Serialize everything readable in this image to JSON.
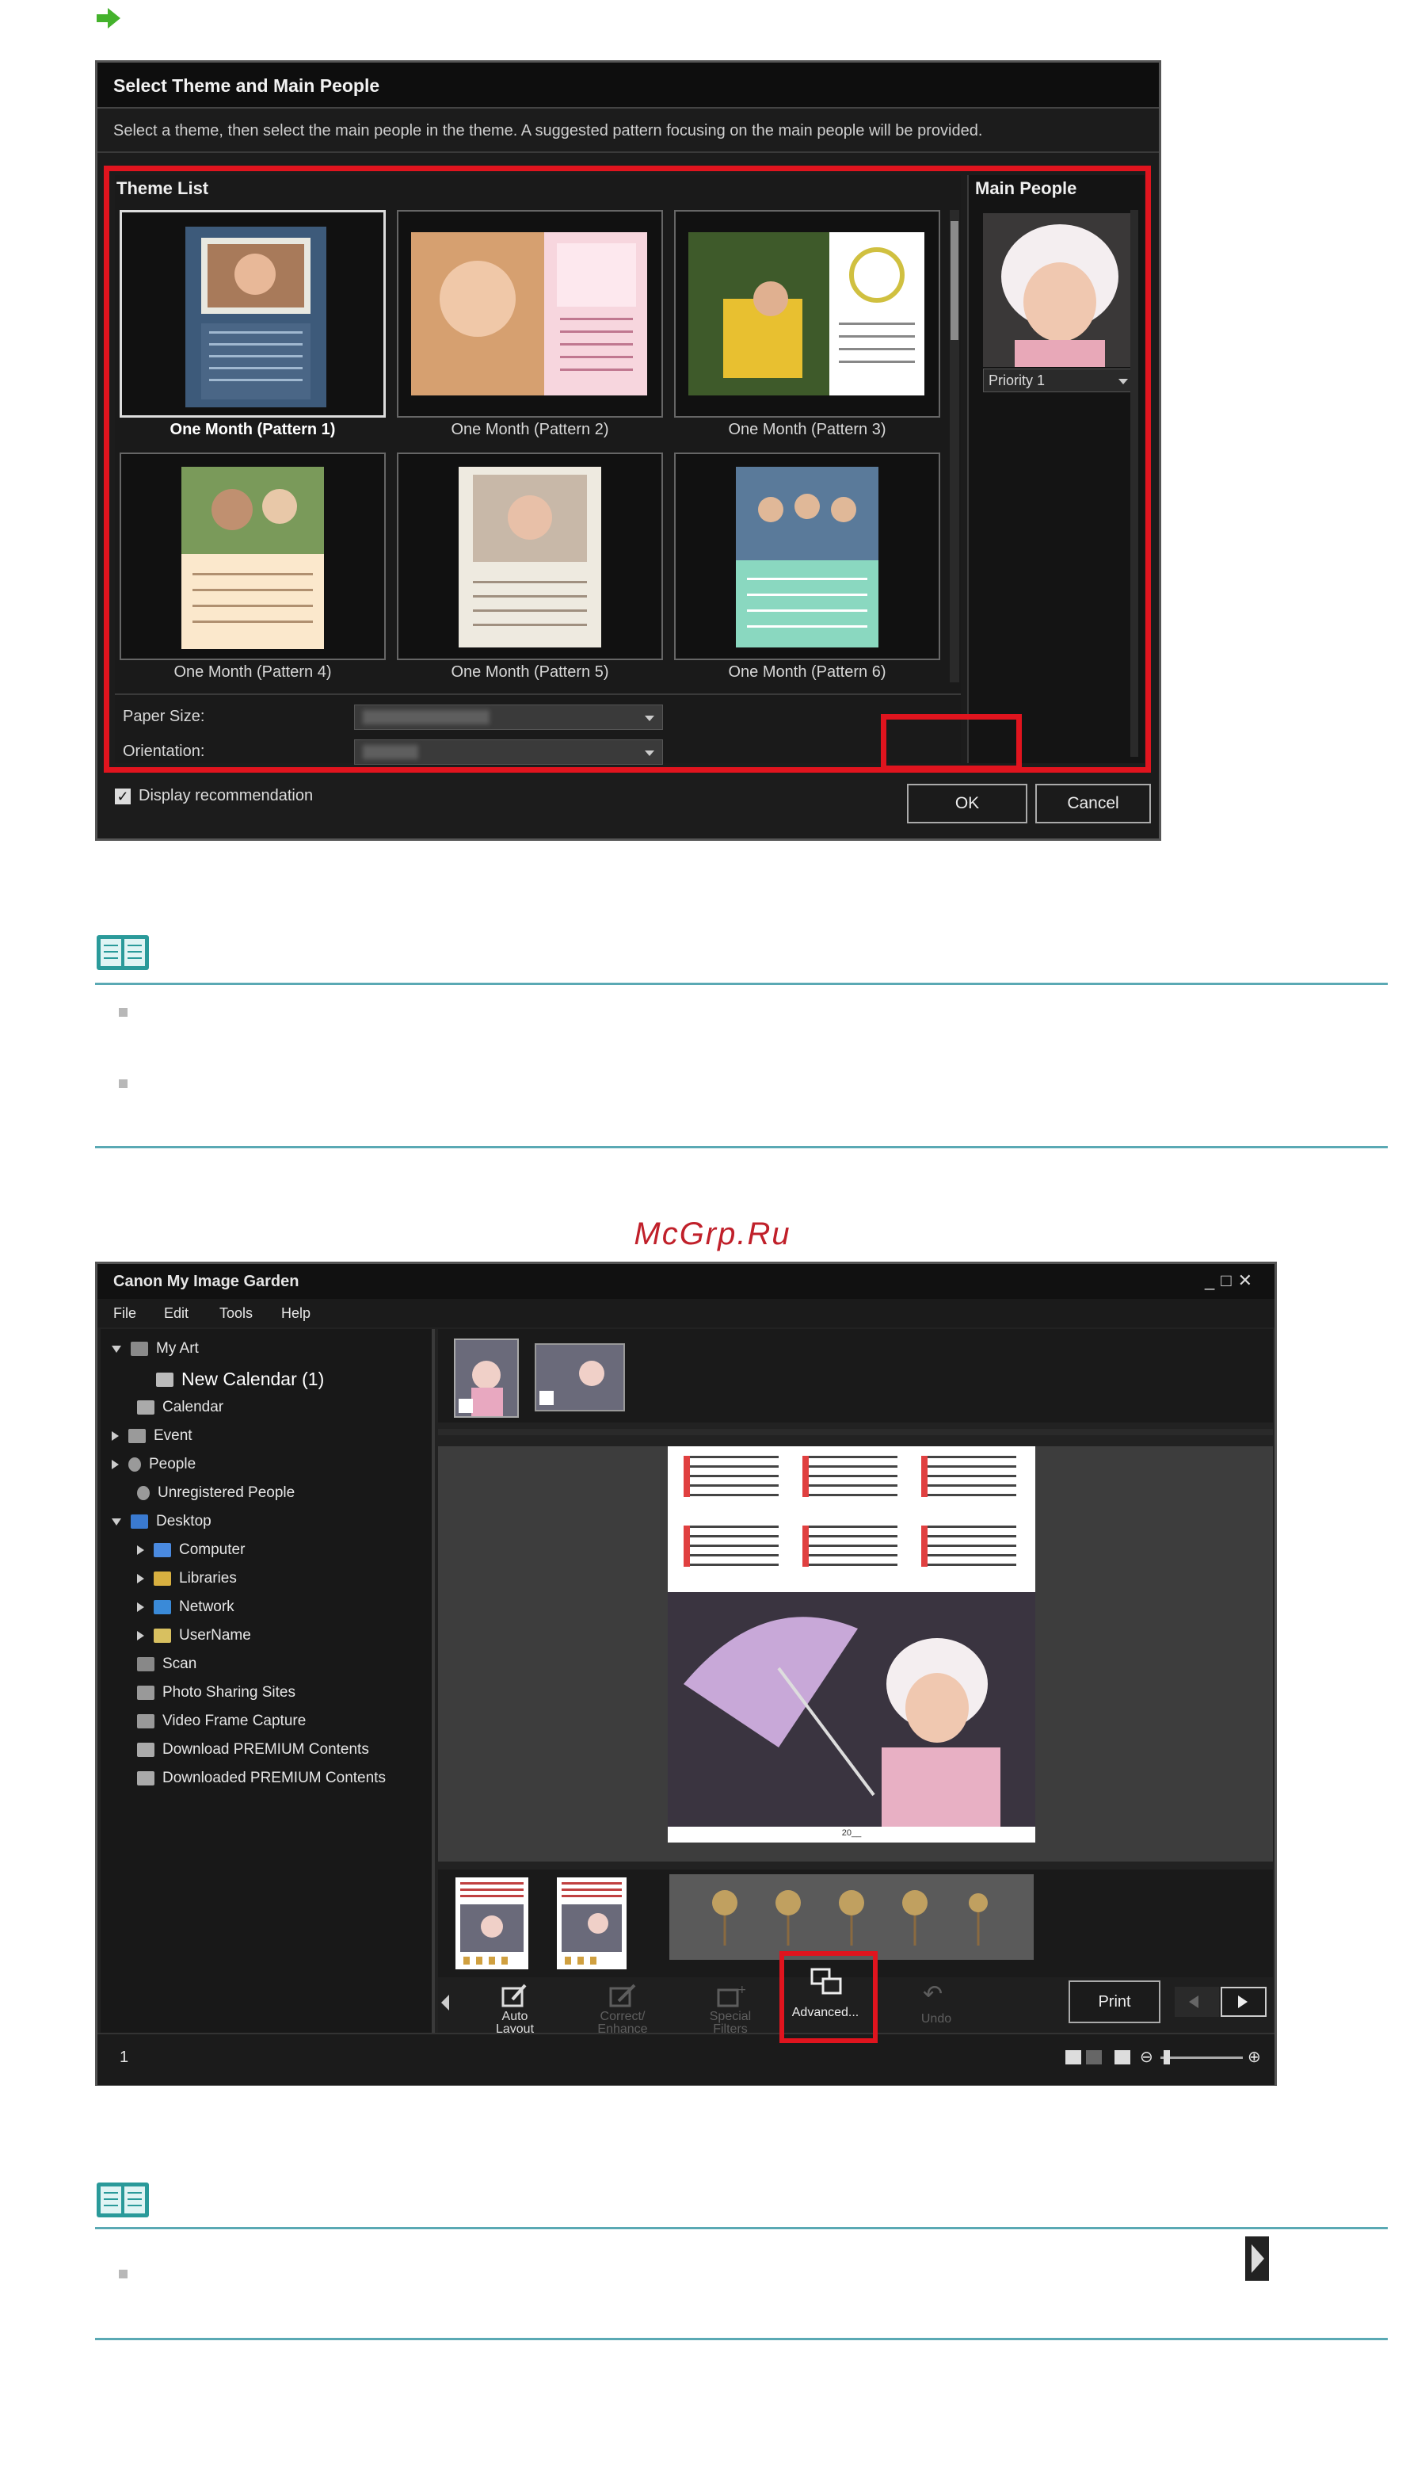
{
  "colors": {
    "accent_red": "#e0141e",
    "note_rule": "#5aa9b4",
    "arrow_green": "#44b22c",
    "watermark": "#c0202a"
  },
  "dialog": {
    "title": "Select Theme and Main People",
    "subtitle": "Select a theme, then select the main people in the theme. A suggested pattern focusing on the main people will be provided.",
    "theme_list_label": "Theme List",
    "main_people_label": "Main People",
    "themes": [
      {
        "caption": "One Month (Pattern 1)"
      },
      {
        "caption": "One Month (Pattern 2)"
      },
      {
        "caption": "One Month (Pattern 3)"
      },
      {
        "caption": "One Month (Pattern 4)"
      },
      {
        "caption": "One Month (Pattern 5)"
      },
      {
        "caption": "One Month (Pattern 6)"
      }
    ],
    "paper_size_label": "Paper Size:",
    "orientation_label": "Orientation:",
    "priority_label": "Priority 1",
    "display_recommendation_label": "Display recommendation",
    "ok_label": "OK",
    "cancel_label": "Cancel"
  },
  "watermark": "McGrp.Ru",
  "app": {
    "title": "Canon My Image Garden",
    "menu": [
      "File",
      "Edit",
      "Tools",
      "Help"
    ],
    "tree": [
      {
        "label": "My Art"
      },
      {
        "label": "New Calendar (1)"
      },
      {
        "label": "Calendar"
      },
      {
        "label": "Event"
      },
      {
        "label": "People"
      },
      {
        "label": "Unregistered People"
      },
      {
        "label": "Desktop"
      },
      {
        "label": "Computer"
      },
      {
        "label": "Libraries"
      },
      {
        "label": "Network"
      },
      {
        "label": "UserName"
      },
      {
        "label": "Scan"
      },
      {
        "label": "Photo Sharing Sites"
      },
      {
        "label": "Video Frame Capture"
      },
      {
        "label": "Download PREMIUM Contents"
      },
      {
        "label": "Downloaded PREMIUM Contents"
      }
    ],
    "toolbar": {
      "auto_layout": "Auto\nLayout",
      "correct_enhance": "Correct/\nEnhance",
      "special_filters": "Special\nFilters",
      "advanced": "Advanced...",
      "undo": "Undo",
      "print": "Print"
    },
    "calendar_year": "20__",
    "status_text": "1"
  }
}
